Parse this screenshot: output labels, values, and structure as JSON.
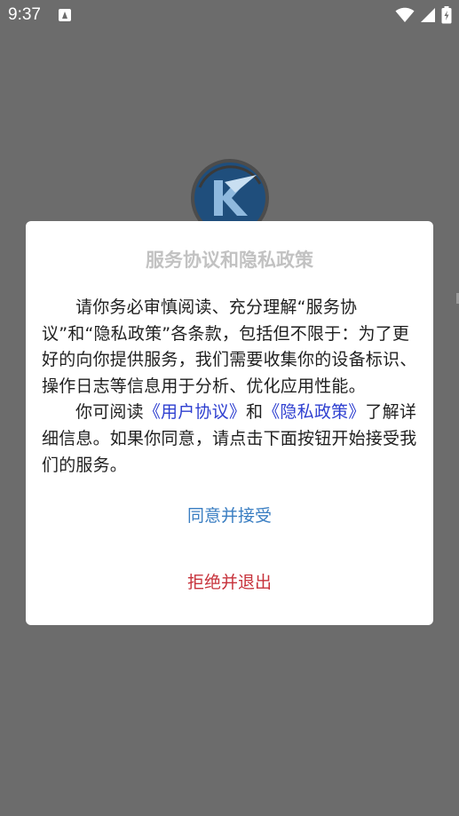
{
  "status_bar": {
    "time": "9:37",
    "notification_icon": "android-notification-icon",
    "icons": [
      "wifi-icon",
      "signal-icon",
      "battery-charging-icon"
    ]
  },
  "backdrop": {
    "logo_icon": "app-logo-icon"
  },
  "dialog": {
    "title": "服务协议和隐私政策",
    "paragraph1": "请你务必审慎阅读、充分理解“服务协议”和“隐私政策”各条款，包括但不限于：为了更好的向你提供服务，我们需要收集你的设备标识、操作日志等信息用于分析、优化应用性能。",
    "paragraph2_prefix": "你可阅读",
    "user_agreement_link": "《用户协议》",
    "and_text": "和",
    "privacy_policy_link": "《隐私政策》",
    "paragraph2_suffix": "了解详细信息。如果你同意，请点击下面按钮开始接受我们的服务。",
    "accept_label": "同意并接受",
    "reject_label": "拒绝并退出"
  },
  "colors": {
    "overlay": "#6c6c6c",
    "accept": "#3a7ec2",
    "reject": "#c7333c",
    "link": "#2e3fd0",
    "title": "#c2c2c2"
  }
}
